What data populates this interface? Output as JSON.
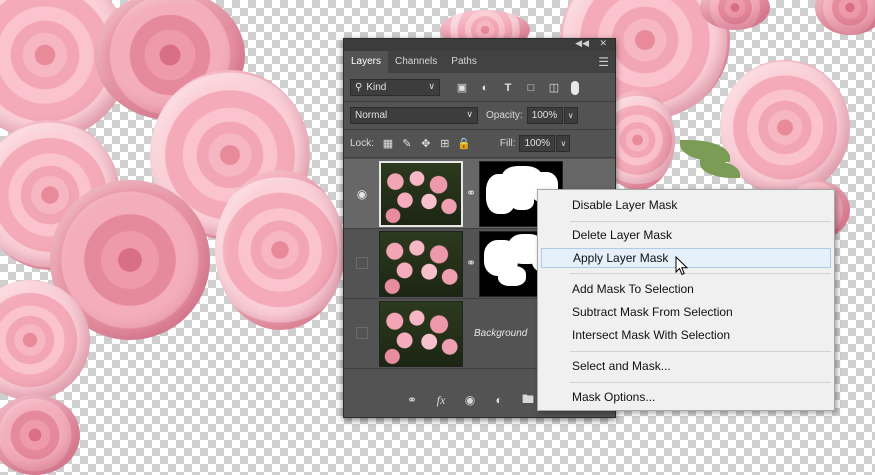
{
  "panel": {
    "tabs": [
      {
        "label": "Layers",
        "active": true
      },
      {
        "label": "Channels",
        "active": false
      },
      {
        "label": "Paths",
        "active": false
      }
    ],
    "filter": {
      "label": "Kind"
    },
    "blend_mode": "Normal",
    "opacity": {
      "label": "Opacity:",
      "value": "100%"
    },
    "lock": {
      "label": "Lock:"
    },
    "fill": {
      "label": "Fill:",
      "value": "100%"
    },
    "layers": [
      {
        "visible": true,
        "selected": true,
        "has_mask": true,
        "name": ""
      },
      {
        "visible": false,
        "selected": false,
        "has_mask": true,
        "name": ""
      },
      {
        "visible": false,
        "selected": false,
        "has_mask": false,
        "name": "Background"
      }
    ],
    "bottom_icons": [
      "link-icon",
      "fx-icon",
      "add-mask-icon",
      "adjustment-icon",
      "folder-icon"
    ],
    "bottom_labels": {
      "fx": "fx"
    }
  },
  "context_menu": {
    "items": [
      {
        "label": "Disable Layer Mask"
      },
      {
        "label": "Delete Layer Mask"
      },
      {
        "label": "Apply Layer Mask",
        "hover": true
      },
      {
        "label": "Add Mask To Selection"
      },
      {
        "label": "Subtract Mask From Selection"
      },
      {
        "label": "Intersect Mask With Selection"
      },
      {
        "label": "Select and Mask..."
      },
      {
        "label": "Mask Options..."
      }
    ]
  },
  "colors": {
    "panel_bg": "#535353",
    "tab_bar": "#424242",
    "selected_layer": "#676767",
    "menu_bg": "#f0f0f0",
    "menu_hover": "#e5f0fb",
    "rose_pink": "#f4aab8"
  }
}
